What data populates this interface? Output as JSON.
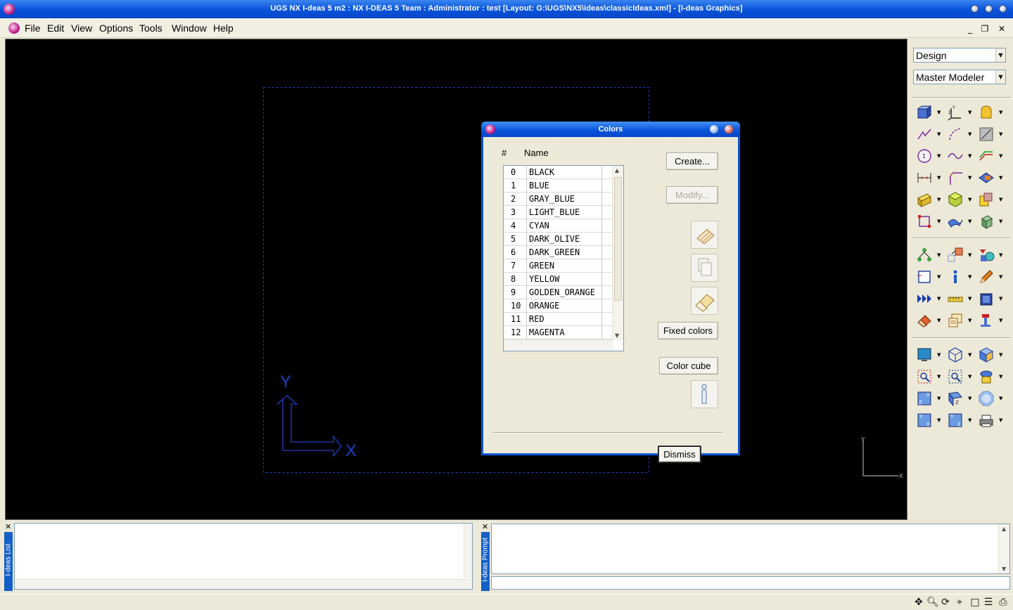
{
  "window": {
    "title": "UGS NX I-deas 5 m2 :    NX I-DEAS 5 Team : Administrator : test   [Layout: G:\\UGS\\NX5\\ideas\\classicIdeas.xml]    - [I-deas Graphics]"
  },
  "menubar": {
    "items": [
      "File",
      "Edit",
      "View",
      "Options",
      "Tools",
      "Window",
      "Help"
    ],
    "mdi_minimize": "_",
    "mdi_restore": "❐",
    "mdi_close": "✕"
  },
  "right_panel": {
    "application": "Design",
    "task": "Master Modeler"
  },
  "viewport": {
    "axis_labels": {
      "y": "Y",
      "x": "X"
    },
    "mini_triad": {
      "y": "Y",
      "x": "X"
    },
    "colors": {
      "background": "#000000",
      "triad": "#1f3dc8",
      "border": "#2440d0"
    }
  },
  "colors_dialog": {
    "title": "Colors",
    "columns": {
      "number": "#",
      "name": "Name"
    },
    "rows": [
      {
        "num": "0",
        "name": "BLACK"
      },
      {
        "num": "1",
        "name": "BLUE"
      },
      {
        "num": "2",
        "name": "GRAY_BLUE"
      },
      {
        "num": "3",
        "name": "LIGHT_BLUE"
      },
      {
        "num": "4",
        "name": "CYAN"
      },
      {
        "num": "5",
        "name": "DARK_OLIVE"
      },
      {
        "num": "6",
        "name": "DARK_GREEN"
      },
      {
        "num": "7",
        "name": "GREEN"
      },
      {
        "num": "8",
        "name": "YELLOW"
      },
      {
        "num": "9",
        "name": "GOLDEN_ORANGE"
      },
      {
        "num": "10",
        "name": "ORANGE"
      },
      {
        "num": "11",
        "name": "RED"
      },
      {
        "num": "12",
        "name": "MAGENTA"
      }
    ],
    "buttons": {
      "create": "Create...",
      "modify": "Modify...",
      "fixed_colors": "Fixed colors",
      "color_cube": "Color cube",
      "dismiss": "Dismiss"
    }
  },
  "bottom_panes": {
    "list_label": "I-deas List",
    "prompt_label": "I-deas Prompt"
  },
  "statusbar_icons": [
    "pan-icon",
    "zoom-icon",
    "rotate-icon",
    "zoom-all-icon",
    "wireframe-icon",
    "list-icon",
    "print-icon"
  ]
}
